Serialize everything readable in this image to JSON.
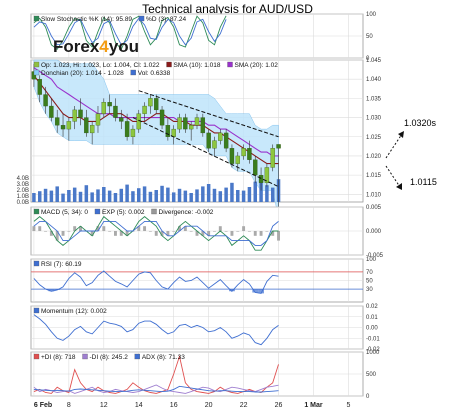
{
  "title": "Technical analysis for AUD/USD",
  "logo": {
    "text_a": "Forex",
    "text_b": "4",
    "text_c": "you",
    "color_a": "#1a1a1a",
    "color_b": "#f39c12"
  },
  "annotations": {
    "high_target": "1.0320s",
    "low_target": "1.0115"
  },
  "chart_data": [
    {
      "type": "line",
      "panel": "stochastic",
      "series": [
        {
          "name": "Slow Stochastic %K (14): 95.89",
          "color": "#2e8b57",
          "values": [
            80,
            90,
            70,
            30,
            20,
            40,
            70,
            90,
            85,
            40,
            25,
            60,
            92,
            80,
            35,
            20,
            50,
            88,
            95,
            60,
            30,
            45,
            85,
            92,
            70,
            30,
            25,
            60,
            95,
            80,
            40,
            30,
            70,
            96
          ]
        },
        {
          "name": "%D (3): 87.24",
          "color": "#3f6fd1",
          "values": [
            70,
            82,
            78,
            50,
            30,
            32,
            55,
            80,
            88,
            60,
            35,
            45,
            78,
            85,
            55,
            30,
            40,
            72,
            90,
            75,
            45,
            42,
            70,
            88,
            80,
            50,
            30,
            45,
            82,
            88,
            60,
            38,
            55,
            88
          ]
        }
      ],
      "ylim": [
        0,
        100
      ],
      "yticks": [
        0,
        50,
        100
      ]
    },
    {
      "type": "candlestick",
      "panel": "price",
      "legend": [
        {
          "text": "Op: 1.023, Hi: 1.023, Lo: 1.004, Cl: 1.022",
          "color": "#90c040"
        },
        {
          "text": "SMA (10): 1.018",
          "color": "#8b1a1a"
        },
        {
          "text": "SMA (20): 1.02",
          "color": "#9932cc"
        },
        {
          "text": "Donchian (20): 1.014 - 1.028",
          "color": "#87cefa"
        },
        {
          "text": "Vol: 0.6338",
          "color": "#3f6fd1"
        }
      ],
      "ylim": [
        1.008,
        1.045
      ],
      "yticks": [
        1.01,
        1.015,
        1.02,
        1.025,
        1.03,
        1.035,
        1.04,
        1.045
      ],
      "vol_ticks": [
        "0.0B",
        "1.0B",
        "2.0B",
        "3.0B",
        "4.0B"
      ],
      "candles": [
        [
          1.042,
          1.044,
          1.038,
          1.04
        ],
        [
          1.04,
          1.041,
          1.034,
          1.036
        ],
        [
          1.036,
          1.038,
          1.031,
          1.033
        ],
        [
          1.033,
          1.035,
          1.029,
          1.03
        ],
        [
          1.03,
          1.032,
          1.026,
          1.028
        ],
        [
          1.028,
          1.031,
          1.025,
          1.027
        ],
        [
          1.027,
          1.03,
          1.024,
          1.029
        ],
        [
          1.029,
          1.033,
          1.027,
          1.032
        ],
        [
          1.032,
          1.035,
          1.028,
          1.03
        ],
        [
          1.03,
          1.032,
          1.025,
          1.026
        ],
        [
          1.026,
          1.029,
          1.023,
          1.028
        ],
        [
          1.028,
          1.033,
          1.026,
          1.031
        ],
        [
          1.031,
          1.035,
          1.03,
          1.034
        ],
        [
          1.034,
          1.036,
          1.031,
          1.033
        ],
        [
          1.033,
          1.035,
          1.029,
          1.03
        ],
        [
          1.03,
          1.032,
          1.027,
          1.029
        ],
        [
          1.029,
          1.031,
          1.024,
          1.025
        ],
        [
          1.025,
          1.028,
          1.023,
          1.027
        ],
        [
          1.027,
          1.032,
          1.026,
          1.031
        ],
        [
          1.031,
          1.034,
          1.029,
          1.033
        ],
        [
          1.033,
          1.036,
          1.031,
          1.035
        ],
        [
          1.035,
          1.036,
          1.031,
          1.032
        ],
        [
          1.032,
          1.033,
          1.027,
          1.028
        ],
        [
          1.028,
          1.03,
          1.024,
          1.025
        ],
        [
          1.025,
          1.028,
          1.023,
          1.027
        ],
        [
          1.027,
          1.031,
          1.026,
          1.03
        ],
        [
          1.03,
          1.031,
          1.026,
          1.027
        ],
        [
          1.027,
          1.029,
          1.024,
          1.028
        ],
        [
          1.028,
          1.031,
          1.027,
          1.03
        ],
        [
          1.03,
          1.031,
          1.025,
          1.026
        ],
        [
          1.026,
          1.027,
          1.021,
          1.022
        ],
        [
          1.022,
          1.025,
          1.02,
          1.024
        ],
        [
          1.024,
          1.027,
          1.023,
          1.026
        ],
        [
          1.026,
          1.027,
          1.021,
          1.022
        ],
        [
          1.022,
          1.023,
          1.017,
          1.018
        ],
        [
          1.018,
          1.021,
          1.016,
          1.02
        ],
        [
          1.02,
          1.023,
          1.019,
          1.022
        ],
        [
          1.022,
          1.024,
          1.018,
          1.019
        ],
        [
          1.019,
          1.02,
          1.013,
          1.015
        ],
        [
          1.015,
          1.017,
          1.011,
          1.013
        ],
        [
          1.013,
          1.018,
          1.012,
          1.017
        ],
        [
          1.017,
          1.023,
          1.016,
          1.022
        ],
        [
          1.023,
          1.023,
          1.004,
          1.022
        ]
      ],
      "sma10": [
        1.041,
        1.039,
        1.037,
        1.035,
        1.033,
        1.031,
        1.03,
        1.03,
        1.03,
        1.029,
        1.029,
        1.029,
        1.03,
        1.031,
        1.031,
        1.031,
        1.03,
        1.029,
        1.029,
        1.029,
        1.03,
        1.031,
        1.031,
        1.03,
        1.029,
        1.029,
        1.029,
        1.028,
        1.028,
        1.028,
        1.027,
        1.026,
        1.026,
        1.025,
        1.024,
        1.023,
        1.022,
        1.021,
        1.02,
        1.019,
        1.018,
        1.018,
        1.018
      ],
      "sma20": [
        1.043,
        1.042,
        1.041,
        1.04,
        1.038,
        1.037,
        1.036,
        1.035,
        1.034,
        1.033,
        1.032,
        1.031,
        1.031,
        1.031,
        1.03,
        1.03,
        1.03,
        1.03,
        1.03,
        1.03,
        1.03,
        1.03,
        1.03,
        1.03,
        1.03,
        1.029,
        1.029,
        1.029,
        1.029,
        1.029,
        1.028,
        1.028,
        1.027,
        1.027,
        1.026,
        1.025,
        1.024,
        1.023,
        1.022,
        1.021,
        1.021,
        1.02,
        1.02
      ],
      "donchian_upper": [
        1.045,
        1.045,
        1.045,
        1.045,
        1.045,
        1.044,
        1.044,
        1.044,
        1.044,
        1.044,
        1.044,
        1.042,
        1.04,
        1.036,
        1.036,
        1.036,
        1.036,
        1.036,
        1.036,
        1.036,
        1.036,
        1.036,
        1.036,
        1.036,
        1.036,
        1.036,
        1.036,
        1.036,
        1.036,
        1.036,
        1.036,
        1.035,
        1.033,
        1.031,
        1.031,
        1.031,
        1.031,
        1.031,
        1.028,
        1.027,
        1.027,
        1.028,
        1.028
      ],
      "donchian_lower": [
        1.038,
        1.034,
        1.031,
        1.029,
        1.026,
        1.025,
        1.024,
        1.024,
        1.024,
        1.024,
        1.023,
        1.023,
        1.023,
        1.023,
        1.023,
        1.023,
        1.023,
        1.023,
        1.023,
        1.023,
        1.023,
        1.023,
        1.023,
        1.023,
        1.023,
        1.023,
        1.023,
        1.023,
        1.023,
        1.023,
        1.021,
        1.02,
        1.02,
        1.02,
        1.017,
        1.016,
        1.016,
        1.016,
        1.013,
        1.011,
        1.011,
        1.011,
        1.004
      ],
      "volume": [
        1.5,
        1.8,
        2.2,
        1.9,
        2.6,
        1.4,
        2.0,
        2.4,
        1.7,
        2.8,
        1.6,
        2.1,
        2.5,
        1.9,
        1.5,
        2.2,
        2.9,
        1.8,
        2.3,
        2.6,
        1.7,
        2.0,
        2.7,
        2.4,
        1.6,
        2.2,
        1.9,
        1.5,
        2.1,
        2.6,
        3.0,
        2.2,
        1.8,
        2.4,
        3.2,
        2.0,
        1.9,
        2.5,
        3.4,
        3.6,
        2.8,
        2.4,
        3.8
      ],
      "trend_upper": [
        [
          18,
          1.037
        ],
        [
          42,
          1.025
        ]
      ],
      "trend_lower": [
        [
          17,
          1.03
        ],
        [
          42,
          1.012
        ]
      ]
    },
    {
      "type": "line",
      "panel": "macd",
      "legend": [
        {
          "text": "MACD (5, 34): 0",
          "color": "#2e8b57"
        },
        {
          "text": "EXP (5): 0.002",
          "color": "#3f6fd1"
        },
        {
          "text": "Divergence: -0.002",
          "color": "#999999"
        }
      ],
      "ylim": [
        -0.005,
        0.005
      ],
      "yticks": [
        -0.005,
        0.0,
        0.005
      ],
      "series": [
        {
          "name": "MACD (5, 34): 0",
          "color": "#2e8b57",
          "values": [
            0.002,
            0.003,
            0.002,
            0.0,
            -0.002,
            -0.003,
            -0.002,
            0.0,
            0.001,
            0.0,
            -0.001,
            0.001,
            0.003,
            0.002,
            0.001,
            0.0,
            -0.001,
            0.0,
            0.002,
            0.003,
            0.002,
            0.001,
            -0.001,
            -0.002,
            -0.001,
            0.001,
            0.002,
            0.001,
            0.0,
            -0.001,
            -0.002,
            -0.001,
            0.0,
            -0.001,
            -0.003,
            -0.002,
            -0.001,
            -0.002,
            -0.004,
            -0.004,
            -0.002,
            0.0,
            0.0
          ]
        },
        {
          "name": "EXP (5): 0.002",
          "color": "#3f6fd1",
          "values": [
            0.001,
            0.002,
            0.002,
            0.001,
            0.0,
            -0.002,
            -0.002,
            -0.001,
            0.0,
            0.0,
            0.0,
            0.0,
            0.002,
            0.002,
            0.002,
            0.001,
            0.0,
            0.0,
            0.001,
            0.002,
            0.002,
            0.002,
            0.0,
            -0.001,
            -0.001,
            0.0,
            0.001,
            0.001,
            0.001,
            0.0,
            -0.001,
            -0.001,
            -0.001,
            -0.001,
            -0.002,
            -0.002,
            -0.002,
            -0.002,
            -0.003,
            -0.003,
            -0.002,
            0.001,
            0.002
          ]
        }
      ],
      "divergence": [
        0.001,
        0.001,
        0.0,
        -0.001,
        -0.002,
        -0.001,
        0.0,
        0.001,
        0.001,
        0.0,
        -0.001,
        0.001,
        0.001,
        0.0,
        -0.001,
        -0.001,
        -0.001,
        0.0,
        0.001,
        0.001,
        0.0,
        -0.001,
        -0.001,
        -0.001,
        0.0,
        0.001,
        0.001,
        0.0,
        -0.001,
        -0.001,
        -0.001,
        0.0,
        0.001,
        0.0,
        -0.001,
        0.0,
        0.001,
        0.0,
        -0.001,
        -0.001,
        0.0,
        -0.001,
        -0.002
      ]
    },
    {
      "type": "line",
      "panel": "rsi",
      "legend": [
        {
          "text": "RSI (7): 60.19",
          "color": "#3f6fd1"
        }
      ],
      "ylim": [
        0,
        100
      ],
      "yticks": [
        30,
        50,
        70,
        100
      ],
      "levels": [
        30,
        70
      ],
      "series": [
        {
          "name": "RSI (7): 60.19",
          "color": "#3f6fd1",
          "values": [
            55,
            40,
            30,
            25,
            28,
            35,
            55,
            68,
            58,
            38,
            45,
            62,
            72,
            60,
            48,
            42,
            35,
            50,
            65,
            70,
            68,
            50,
            35,
            30,
            45,
            58,
            48,
            50,
            58,
            45,
            32,
            42,
            52,
            38,
            25,
            40,
            52,
            42,
            22,
            20,
            48,
            62,
            60
          ]
        }
      ]
    },
    {
      "type": "line",
      "panel": "momentum",
      "legend": [
        {
          "text": "Momentum (12): 0.002",
          "color": "#3f6fd1"
        }
      ],
      "ylim": [
        -0.02,
        0.02
      ],
      "yticks": [
        -0.02,
        -0.01,
        0.0,
        0.01,
        0.02
      ],
      "series": [
        {
          "name": "Momentum (12): 0.002",
          "color": "#3f6fd1",
          "values": [
            0.012,
            0.008,
            0.003,
            -0.004,
            -0.01,
            -0.012,
            -0.008,
            -0.002,
            0.001,
            -0.004,
            -0.006,
            0.0,
            0.006,
            0.004,
            0.003,
            0.001,
            -0.004,
            -0.002,
            0.004,
            0.006,
            0.006,
            0.003,
            -0.002,
            -0.006,
            -0.004,
            0.002,
            0.003,
            0.0,
            0.002,
            0.0,
            -0.004,
            -0.003,
            0.0,
            -0.004,
            -0.01,
            -0.008,
            -0.005,
            -0.007,
            -0.014,
            -0.016,
            -0.01,
            -0.002,
            0.002
          ]
        }
      ]
    },
    {
      "type": "line",
      "panel": "adx",
      "legend": [
        {
          "text": "+DI (8): 718",
          "color": "#e05050"
        },
        {
          "text": "-DI (8): 245.2",
          "color": "#9f7fd0"
        },
        {
          "text": "ADX (8): 71.33",
          "color": "#3f6fd1"
        }
      ],
      "ylim": [
        0,
        1000
      ],
      "yticks": [
        0,
        500,
        1000
      ],
      "series": [
        {
          "name": "+DI (8): 718",
          "color": "#e05050",
          "values": [
            100,
            150,
            80,
            60,
            200,
            120,
            80,
            600,
            300,
            150,
            100,
            200,
            120,
            80,
            60,
            100,
            150,
            300,
            200,
            120,
            80,
            60,
            100,
            150,
            500,
            900,
            300,
            150,
            100,
            80,
            60,
            100,
            200,
            120,
            80,
            60,
            100,
            150,
            100,
            80,
            200,
            300,
            718
          ]
        },
        {
          "name": "-DI (8): 245.2",
          "color": "#9f7fd0",
          "values": [
            200,
            100,
            150,
            120,
            80,
            100,
            120,
            60,
            100,
            150,
            200,
            120,
            80,
            100,
            150,
            120,
            100,
            80,
            100,
            150,
            200,
            250,
            180,
            120,
            100,
            80,
            60,
            100,
            150,
            200,
            180,
            120,
            100,
            150,
            200,
            180,
            150,
            120,
            100,
            150,
            200,
            220,
            245
          ]
        },
        {
          "name": "ADX (8): 71.33",
          "color": "#3f6fd1",
          "values": [
            150,
            140,
            130,
            120,
            130,
            120,
            110,
            150,
            160,
            150,
            140,
            130,
            120,
            110,
            100,
            100,
            110,
            130,
            140,
            130,
            120,
            110,
            100,
            110,
            150,
            220,
            200,
            180,
            160,
            140,
            120,
            110,
            120,
            120,
            110,
            100,
            100,
            100,
            90,
            90,
            100,
            110,
            120
          ]
        }
      ]
    }
  ],
  "x_axis": {
    "labels": [
      "6 Feb",
      "8",
      "12",
      "14",
      "16",
      "20",
      "22",
      "26",
      "1 Mar",
      "5"
    ],
    "index": [
      0,
      6,
      12,
      18,
      24,
      30,
      36,
      42,
      48,
      54
    ],
    "count": 57
  }
}
